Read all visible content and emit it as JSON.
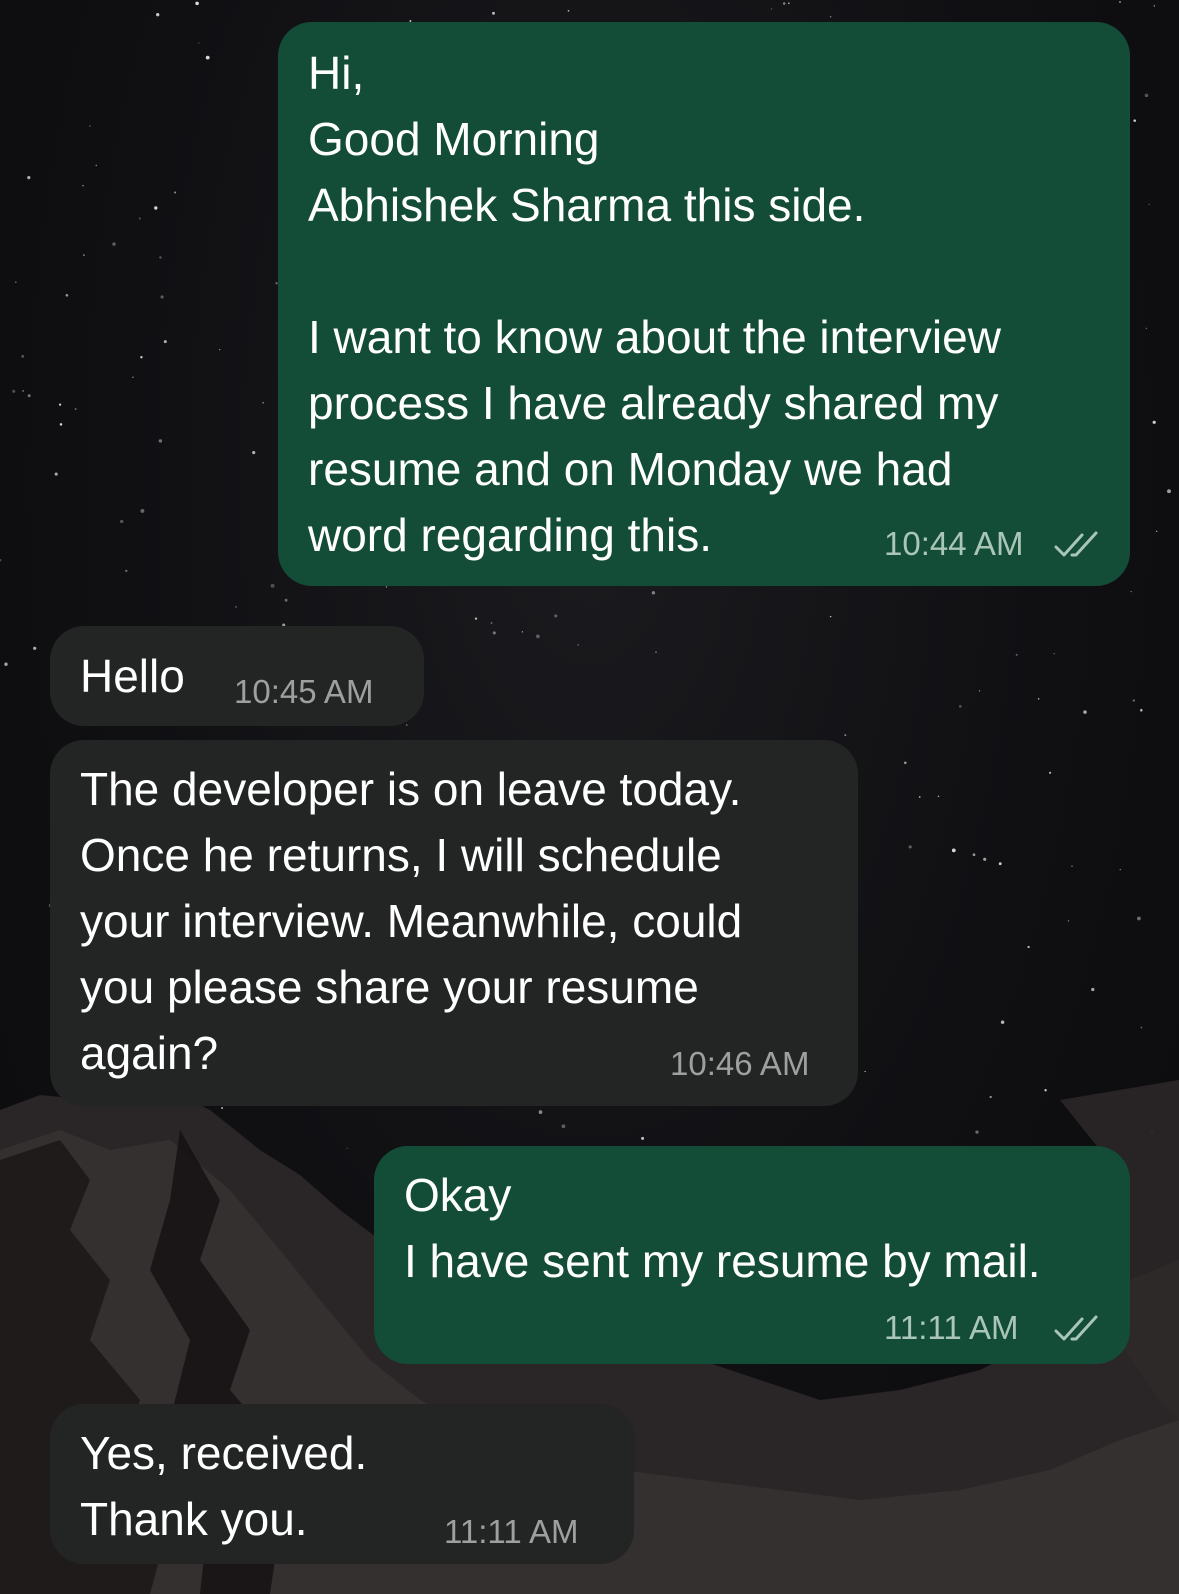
{
  "theme": {
    "outgoing_bubble": "#134d37",
    "incoming_bubble": "#232424",
    "text": "#ffffff",
    "read_receipt_icon": "double-check-icon"
  },
  "messages": [
    {
      "direction": "outgoing",
      "lines": [
        "Hi,",
        "Good Morning",
        "Abhishek Sharma this side.",
        "",
        "I want to know about the interview",
        "process I have already shared my",
        "resume and on Monday we had",
        "word regarding this."
      ],
      "time": "10:44 AM",
      "status": "read"
    },
    {
      "direction": "incoming",
      "lines": [
        "Hello"
      ],
      "time": "10:45 AM"
    },
    {
      "direction": "incoming",
      "lines": [
        "The developer is on leave today.",
        "Once he returns, I will schedule",
        "your interview. Meanwhile, could",
        "you please share your resume",
        "again?"
      ],
      "time": "10:46 AM"
    },
    {
      "direction": "outgoing",
      "lines": [
        "Okay",
        "I have sent my resume by mail."
      ],
      "time": "11:11 AM",
      "status": "read"
    },
    {
      "direction": "incoming",
      "lines": [
        "Yes, received.",
        "Thank you."
      ],
      "time": "11:11 AM"
    }
  ]
}
